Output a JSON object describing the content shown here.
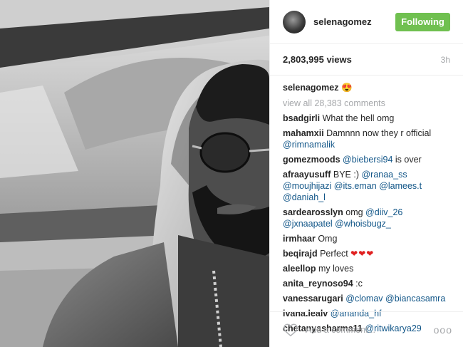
{
  "post": {
    "photo_alt": "selfie photo"
  },
  "header": {
    "username": "selenagomez",
    "follow_label": "Following"
  },
  "stats": {
    "views": "2,803,995 views",
    "age": "3h"
  },
  "caption": {
    "username": "selenagomez",
    "emoji": "😍"
  },
  "view_all": "view all 28,383 comments",
  "comments": [
    {
      "user": "bsadgirli",
      "parts": [
        {
          "t": "text",
          "v": " What the hell omg"
        }
      ]
    },
    {
      "user": "mahamxii",
      "parts": [
        {
          "t": "text",
          "v": " Damnnn now they r official "
        },
        {
          "t": "mention",
          "v": "@rimnamalik"
        }
      ]
    },
    {
      "user": "gomezmoods",
      "parts": [
        {
          "t": "text",
          "v": " "
        },
        {
          "t": "mention",
          "v": "@biebersi94"
        },
        {
          "t": "text",
          "v": " is over"
        }
      ]
    },
    {
      "user": "afraayusuff",
      "parts": [
        {
          "t": "text",
          "v": " BYE :) "
        },
        {
          "t": "mention",
          "v": "@ranaa_ss"
        },
        {
          "t": "text",
          "v": " "
        },
        {
          "t": "mention",
          "v": "@moujhijazi"
        },
        {
          "t": "text",
          "v": " "
        },
        {
          "t": "mention",
          "v": "@its.eman"
        },
        {
          "t": "text",
          "v": " "
        },
        {
          "t": "mention",
          "v": "@lamees.t"
        },
        {
          "t": "text",
          "v": " "
        },
        {
          "t": "mention",
          "v": "@daniah_l"
        }
      ]
    },
    {
      "user": "sardearosslyn",
      "parts": [
        {
          "t": "text",
          "v": " omg "
        },
        {
          "t": "mention",
          "v": "@diiv_26"
        },
        {
          "t": "text",
          "v": " "
        },
        {
          "t": "mention",
          "v": "@jxnaapatel"
        },
        {
          "t": "text",
          "v": " "
        },
        {
          "t": "mention",
          "v": "@whoisbugz_"
        }
      ]
    },
    {
      "user": "irmhaar",
      "parts": [
        {
          "t": "text",
          "v": " Omg"
        }
      ]
    },
    {
      "user": "beqirajd",
      "parts": [
        {
          "t": "text",
          "v": " Perfect "
        },
        {
          "t": "hearts",
          "v": "❤❤❤"
        }
      ]
    },
    {
      "user": "aleellop",
      "parts": [
        {
          "t": "text",
          "v": " my loves"
        }
      ]
    },
    {
      "user": "anita_reynoso94",
      "parts": [
        {
          "t": "text",
          "v": " :c"
        }
      ]
    },
    {
      "user": "vanessarugari",
      "parts": [
        {
          "t": "text",
          "v": " "
        },
        {
          "t": "mention",
          "v": "@clomav"
        },
        {
          "t": "text",
          "v": " "
        },
        {
          "t": "mention",
          "v": "@biancasamra"
        }
      ]
    },
    {
      "user": "ivana.lealv",
      "parts": [
        {
          "t": "text",
          "v": " "
        },
        {
          "t": "mention",
          "v": "@ananda_hf"
        }
      ]
    },
    {
      "user": "chetanyasharma11",
      "parts": [
        {
          "t": "text",
          "v": " "
        },
        {
          "t": "mention",
          "v": "@ritwikarya29"
        }
      ]
    }
  ],
  "footer": {
    "add_comment_placeholder": "Add a comment...",
    "more_glyph": "ooo"
  },
  "icons": {
    "like": "heart-outline-icon",
    "more": "more-options-icon"
  },
  "colors": {
    "follow_green": "#70c050",
    "mention_blue": "#125688",
    "muted_gray": "#a5a7aa"
  }
}
